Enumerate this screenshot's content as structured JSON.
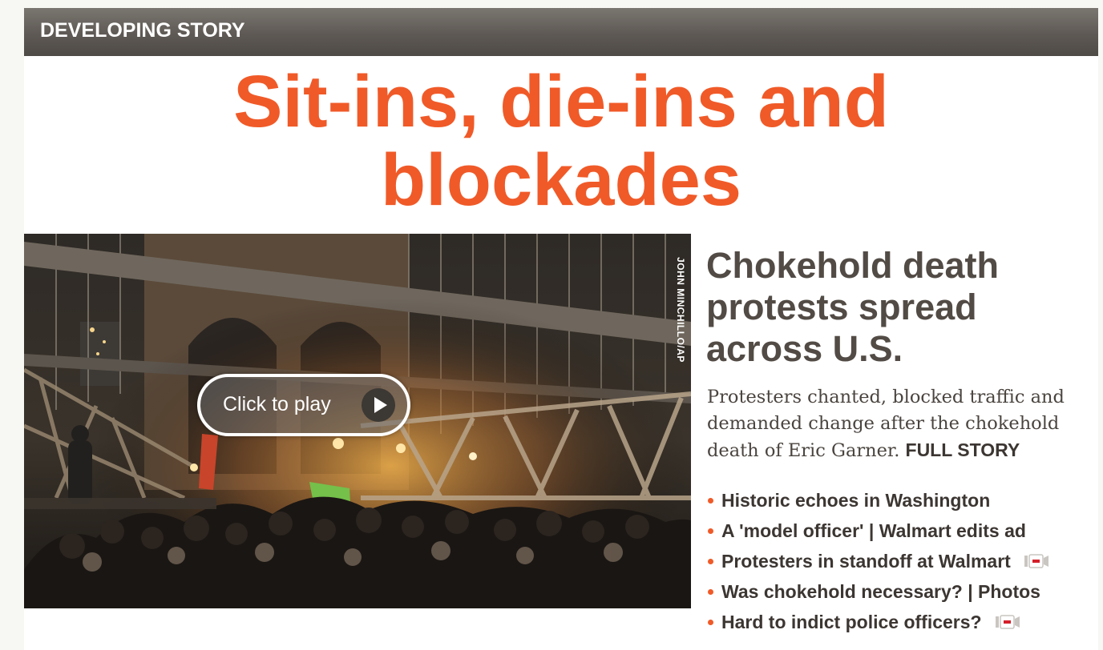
{
  "banner": {
    "label": "DEVELOPING STORY"
  },
  "headline": {
    "line1": "Sit-ins, die-ins and",
    "line2": "blockades"
  },
  "media": {
    "photo_credit": "JOHN MINCHILLO/AP",
    "play_label": "Click to play",
    "play_icon": "play-icon"
  },
  "story": {
    "title_line1": "Chokehold death",
    "title_line2": "protests spread",
    "title_line3": "across U.S.",
    "summary": "Protesters chanted, blocked traffic and demanded change after the chokehold death of Eric Garner.",
    "full_story_label": "FULL STORY"
  },
  "related_links": [
    {
      "text": "Historic echoes in Washington",
      "video": false
    },
    {
      "text": "A 'model officer' | Walmart edits ad",
      "video": false
    },
    {
      "text": "Protesters in standoff at Walmart",
      "video": true
    },
    {
      "text": "Was chokehold necessary? | Photos",
      "video": false
    },
    {
      "text": "Hard to indict police officers?",
      "video": true
    }
  ],
  "colors": {
    "accent": "#f05a28",
    "banner": "#5e5954",
    "story_title": "#524b45",
    "link_text": "#3c3632"
  }
}
